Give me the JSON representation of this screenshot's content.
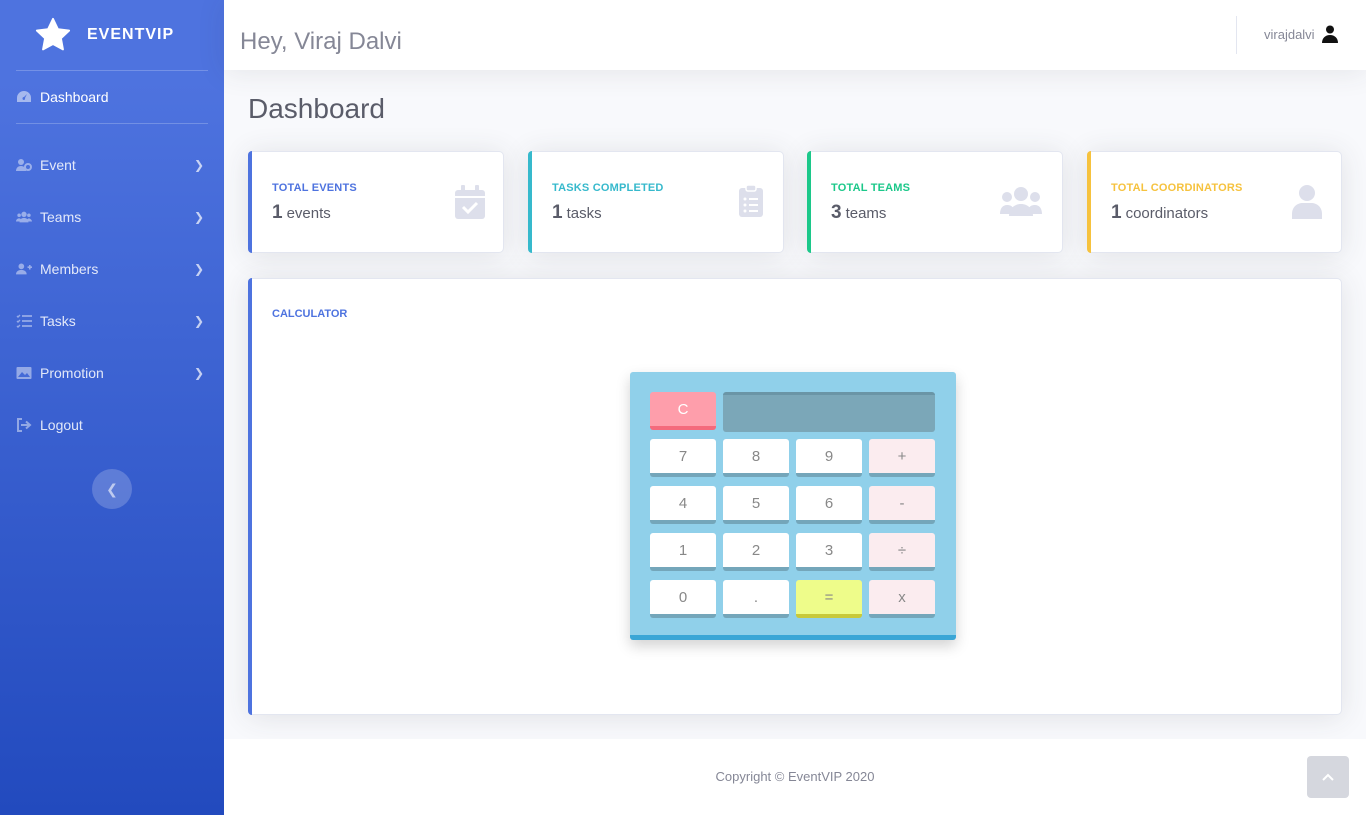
{
  "brand": {
    "name": "EVENTVIP",
    "icon": "star-icon"
  },
  "sidebar": {
    "dashboard_label": "Dashboard",
    "items": [
      {
        "label": "Event",
        "icon": "users-cog-icon"
      },
      {
        "label": "Teams",
        "icon": "users-icon"
      },
      {
        "label": "Members",
        "icon": "user-plus-icon"
      },
      {
        "label": "Tasks",
        "icon": "tasks-icon"
      },
      {
        "label": "Promotion",
        "icon": "image-icon"
      },
      {
        "label": "Logout",
        "icon": "sign-out-icon"
      }
    ]
  },
  "topbar": {
    "greeting": "Hey, Viraj Dalvi",
    "username": "virajdalvi"
  },
  "page": {
    "title": "Dashboard"
  },
  "stats": [
    {
      "title": "TOTAL EVENTS",
      "value": "1",
      "unit": "events",
      "color": "#4e73df",
      "icon": "calendar-check-icon"
    },
    {
      "title": "TASKS COMPLETED",
      "value": "1",
      "unit": "tasks",
      "color": "#36b9cc",
      "icon": "clipboard-list-icon"
    },
    {
      "title": "TOTAL TEAMS",
      "value": "3",
      "unit": "teams",
      "color": "#1cc88a",
      "icon": "users-icon"
    },
    {
      "title": "TOTAL COORDINATORS",
      "value": "1",
      "unit": "coordinators",
      "color": "#f6c23e",
      "icon": "user-icon"
    }
  ],
  "calculator": {
    "title": "CALCULATOR",
    "display": "",
    "clear": "C",
    "keys": [
      [
        "7",
        "8",
        "9",
        "+"
      ],
      [
        "4",
        "5",
        "6",
        "-"
      ],
      [
        "1",
        "2",
        "3",
        "÷"
      ],
      [
        "0",
        ".",
        "=",
        "x"
      ]
    ]
  },
  "footer": {
    "copyright": "Copyright © EventVIP 2020"
  }
}
